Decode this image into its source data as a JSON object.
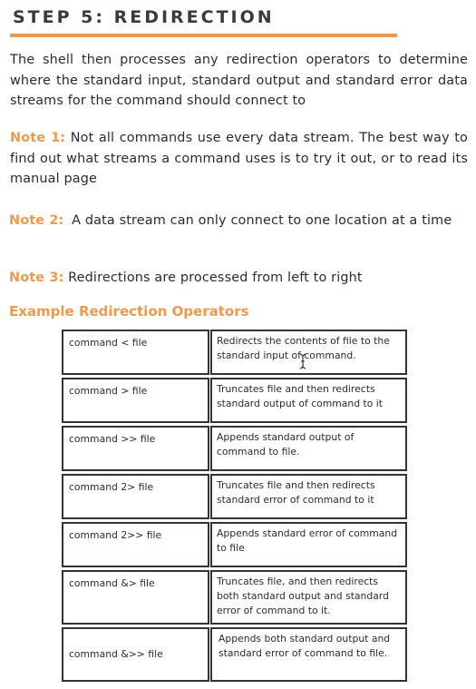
{
  "heading": {
    "title": "STEP 5: REDIRECTION"
  },
  "intro": "The shell then processes any redirection operators to determine where the standard input, standard output and standard error data streams for the command should connect to",
  "notes": [
    {
      "label": "Note 1:",
      "text": "Not all commands use every data stream. The best way to find out what streams a command uses is to try it out, or to read its manual page"
    },
    {
      "label": "Note 2:",
      "text": "A data stream can only connect to one location at a time"
    },
    {
      "label": "Note 3:",
      "text": "Redirections are processed from left to right"
    }
  ],
  "example_title": "Example Redirection Operators",
  "operators": [
    {
      "op": "command < file",
      "desc": "Redirects the contents of file to the standard input of command."
    },
    {
      "op": "command > file",
      "desc": "Truncates file and then redirects standard output of command to it"
    },
    {
      "op": "command >> file",
      "desc": "Appends standard output of command to file."
    },
    {
      "op": "command 2> file",
      "desc": "Truncates file and then redirects standard error of command to it"
    },
    {
      "op": "command 2>> file",
      "desc": "Appends standard error of command to file"
    },
    {
      "op": "command &> file",
      "desc": "Truncates file, and then redirects both standard output and standard error of command to it."
    },
    {
      "op": "command &>> file",
      "desc": "Appends both standard output and standard error of command to file."
    }
  ],
  "icons": {
    "cursor": "text-cursor-icon"
  },
  "colors": {
    "accent": "#ee9a4d",
    "text": "#2b2b2b",
    "border": "#333333"
  }
}
